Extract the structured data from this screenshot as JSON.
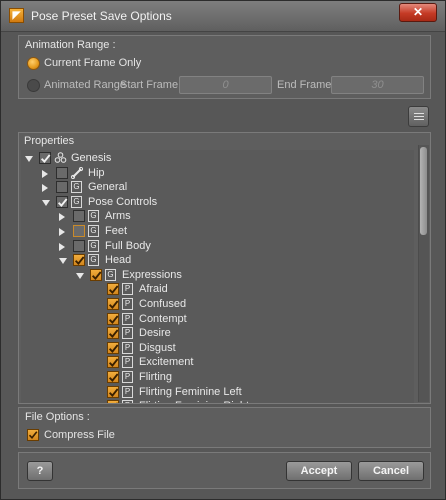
{
  "window": {
    "title": "Pose Preset Save Options",
    "close_glyph": "✕",
    "app_icon": "daz-icon"
  },
  "animation_range": {
    "title": "Animation Range :",
    "current_frame_label": "Current Frame Only",
    "animated_range_label": "Animated Range",
    "start_frame_label": "Start Frame :",
    "start_frame_value": "0",
    "end_frame_label": "End Frame :",
    "end_frame_value": "30",
    "selected": "current_frame"
  },
  "properties": {
    "title": "Properties",
    "tree": [
      {
        "label": "Genesis",
        "icon": "figure-icon",
        "state": "checked"
      },
      {
        "label": "Hip",
        "icon": "bone-icon",
        "state": "unchecked"
      },
      {
        "label": "General",
        "icon_glyph": "G",
        "state": "unchecked"
      },
      {
        "label": "Pose Controls",
        "icon_glyph": "G",
        "state": "checked"
      },
      {
        "label": "Arms",
        "icon_glyph": "G",
        "state": "unchecked"
      },
      {
        "label": "Feet",
        "icon_glyph": "G",
        "state": "partial"
      },
      {
        "label": "Full Body",
        "icon_glyph": "G",
        "state": "unchecked"
      },
      {
        "label": "Head",
        "icon_glyph": "G",
        "state": "checked"
      },
      {
        "label": "Expressions",
        "icon_glyph": "G",
        "state": "checked"
      },
      {
        "label": "Afraid",
        "icon_glyph": "P",
        "state": "checked"
      },
      {
        "label": "Confused",
        "icon_glyph": "P",
        "state": "checked"
      },
      {
        "label": "Contempt",
        "icon_glyph": "P",
        "state": "checked"
      },
      {
        "label": "Desire",
        "icon_glyph": "P",
        "state": "checked"
      },
      {
        "label": "Disgust",
        "icon_glyph": "P",
        "state": "checked"
      },
      {
        "label": "Excitement",
        "icon_glyph": "P",
        "state": "checked"
      },
      {
        "label": "Flirting",
        "icon_glyph": "P",
        "state": "checked"
      },
      {
        "label": "Flirting Feminine Left",
        "icon_glyph": "P",
        "state": "checked"
      },
      {
        "label": "Flirting Feminine Right",
        "icon_glyph": "P",
        "state": "checked"
      }
    ]
  },
  "file_options": {
    "title": "File Options :",
    "compress_label": "Compress File",
    "compress_checked": true
  },
  "buttons": {
    "help_glyph": "?",
    "accept": "Accept",
    "cancel": "Cancel"
  },
  "colors": {
    "accent": "#e59a1d",
    "background": "#575757"
  }
}
